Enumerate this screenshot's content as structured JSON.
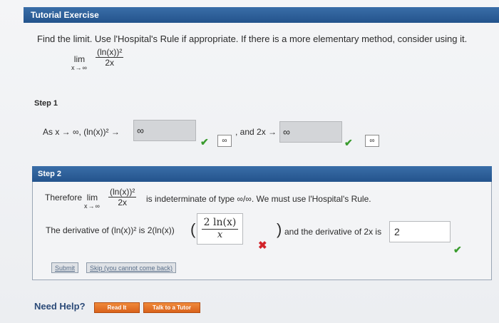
{
  "header": {
    "title": "Tutorial Exercise"
  },
  "problem": {
    "instructions": "Find the limit. Use l'Hospital's Rule if appropriate. If there is a more elementary method, consider using it.",
    "lim": "lim",
    "lim_sub": "x→∞",
    "numerator": "(ln(x))²",
    "denominator": "2x"
  },
  "step1": {
    "label": "Step 1",
    "prefix": "As x → ∞, (ln(x))² →",
    "answer1": "∞",
    "hint1": "∞",
    "middle": ", and 2x →",
    "answer2": "∞",
    "hint2": "∞"
  },
  "step2": {
    "label": "Step 2",
    "therefore": "Therefore",
    "lim": "lim",
    "lim_sub": "x→∞",
    "numerator": "(ln(x))²",
    "denominator": "2x",
    "indeterminate_text": "is indeterminate of type ∞/∞. We must use l'Hospital's Rule.",
    "derivative_prefix": "The derivative of (ln(x))² is 2(ln(x))",
    "input_numerator": "2 ln(x)",
    "input_denominator": "x",
    "derivative_suffix": "and the derivative of 2x is",
    "answer_2x": "2",
    "submit_label": "Submit",
    "skip_label": "Skip (you cannot come back)"
  },
  "help": {
    "label": "Need Help?",
    "read_it": "Read It",
    "talk_tutor": "Talk to a Tutor"
  },
  "colors": {
    "header_blue": "#23538c",
    "correct_green": "#3a9c2e",
    "incorrect_red": "#d2232a",
    "help_orange": "#d9621b"
  }
}
